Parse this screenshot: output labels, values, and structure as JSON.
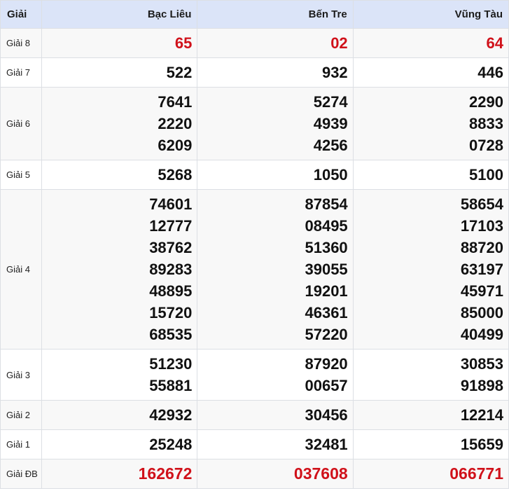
{
  "header": {
    "col_label": "Giải",
    "provinces": [
      "Bạc Liêu",
      "Bến Tre",
      "Vũng Tàu"
    ]
  },
  "rows": [
    {
      "label": "Giải 8",
      "highlight": true,
      "values": [
        [
          "65"
        ],
        [
          "02"
        ],
        [
          "64"
        ]
      ]
    },
    {
      "label": "Giải 7",
      "highlight": false,
      "values": [
        [
          "522"
        ],
        [
          "932"
        ],
        [
          "446"
        ]
      ]
    },
    {
      "label": "Giải 6",
      "highlight": false,
      "values": [
        [
          "7641",
          "2220",
          "6209"
        ],
        [
          "5274",
          "4939",
          "4256"
        ],
        [
          "2290",
          "8833",
          "0728"
        ]
      ]
    },
    {
      "label": "Giải 5",
      "highlight": false,
      "values": [
        [
          "5268"
        ],
        [
          "1050"
        ],
        [
          "5100"
        ]
      ]
    },
    {
      "label": "Giải 4",
      "highlight": false,
      "values": [
        [
          "74601",
          "12777",
          "38762",
          "89283",
          "48895",
          "15720",
          "68535"
        ],
        [
          "87854",
          "08495",
          "51360",
          "39055",
          "19201",
          "46361",
          "57220"
        ],
        [
          "58654",
          "17103",
          "88720",
          "63197",
          "45971",
          "85000",
          "40499"
        ]
      ]
    },
    {
      "label": "Giải 3",
      "highlight": false,
      "values": [
        [
          "51230",
          "55881"
        ],
        [
          "87920",
          "00657"
        ],
        [
          "30853",
          "91898"
        ]
      ]
    },
    {
      "label": "Giải 2",
      "highlight": false,
      "values": [
        [
          "42932"
        ],
        [
          "30456"
        ],
        [
          "12214"
        ]
      ]
    },
    {
      "label": "Giải 1",
      "highlight": false,
      "values": [
        [
          "25248"
        ],
        [
          "32481"
        ],
        [
          "15659"
        ]
      ]
    },
    {
      "label": "Giải ĐB",
      "highlight": true,
      "values": [
        [
          "162672"
        ],
        [
          "037608"
        ],
        [
          "066771"
        ]
      ]
    }
  ],
  "colors": {
    "highlight": "#d0111a",
    "header_bg": "#dbe4f8"
  }
}
